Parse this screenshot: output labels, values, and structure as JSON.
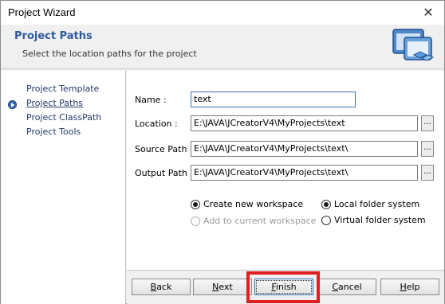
{
  "window": {
    "title": "Project Wizard"
  },
  "header": {
    "title": "Project Paths",
    "subtitle": "Select the location paths for the project"
  },
  "steps": [
    {
      "label": "Project Template",
      "current": false
    },
    {
      "label": "Project Paths",
      "current": true
    },
    {
      "label": "Project ClassPath",
      "current": false
    },
    {
      "label": "Project Tools",
      "current": false
    }
  ],
  "form": {
    "name": {
      "label": "Name :",
      "value": "text"
    },
    "location": {
      "label": "Location :",
      "value": "E:\\JAVA\\JCreatorV4\\MyProjects\\text"
    },
    "source_path": {
      "label": "Source Path :",
      "value": "E:\\JAVA\\JCreatorV4\\MyProjects\\text\\"
    },
    "output_path": {
      "label": "Output Path :",
      "value": "E:\\JAVA\\JCreatorV4\\MyProjects\\text\\"
    },
    "browse_label": "..."
  },
  "options": {
    "workspace": [
      {
        "label": "Create new workspace",
        "checked": true,
        "disabled": false
      },
      {
        "label": "Add to current workspace",
        "checked": false,
        "disabled": true
      }
    ],
    "folder": [
      {
        "label": "Local folder system",
        "checked": true
      },
      {
        "label": "Virtual folder system",
        "checked": false
      }
    ]
  },
  "buttons": {
    "back": {
      "accel": "B",
      "rest": "ack"
    },
    "next": {
      "accel": "N",
      "rest": "ext"
    },
    "finish": {
      "accel": "F",
      "rest": "inish"
    },
    "cancel": {
      "accel": "C",
      "rest": "ancel"
    },
    "help": {
      "accel": "H",
      "rest": "elp"
    }
  },
  "close_glyph": "✕",
  "accent_color": "#e02020"
}
